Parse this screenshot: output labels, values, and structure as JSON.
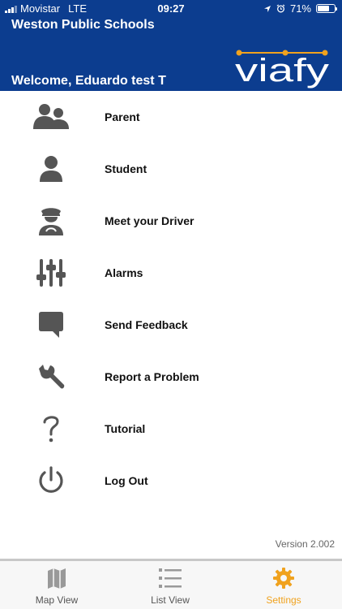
{
  "status_bar": {
    "carrier": "Movistar",
    "network": "LTE",
    "time": "09:27",
    "battery": "71%",
    "battery_level": 0.71
  },
  "header": {
    "district": "Weston Public Schools",
    "welcome": "Welcome, Eduardo test T",
    "logo_text": "viafy",
    "background_color": "#0c3d8f"
  },
  "menu": {
    "items": [
      {
        "label": "Parent",
        "icon": "parent-icon"
      },
      {
        "label": "Student",
        "icon": "student-icon"
      },
      {
        "label": "Meet your Driver",
        "icon": "driver-icon"
      },
      {
        "label": "Alarms",
        "icon": "sliders-icon"
      },
      {
        "label": "Send Feedback",
        "icon": "chat-bubble-icon"
      },
      {
        "label": "Report a Problem",
        "icon": "wrench-icon"
      },
      {
        "label": "Tutorial",
        "icon": "question-icon"
      },
      {
        "label": "Log Out",
        "icon": "power-icon"
      }
    ],
    "icon_color": "#555555"
  },
  "version": "Version 2.002",
  "tabs": [
    {
      "label": "Map View",
      "icon": "map-icon",
      "active": false
    },
    {
      "label": "List View",
      "icon": "list-icon",
      "active": false
    },
    {
      "label": "Settings",
      "icon": "gear-icon",
      "active": true
    }
  ],
  "accent_color": "#f0a21e"
}
